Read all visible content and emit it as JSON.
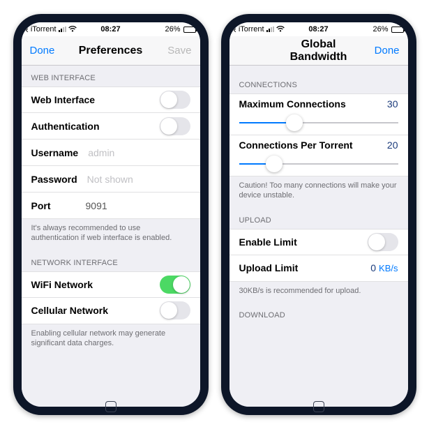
{
  "status": {
    "app_name": "iTorrent",
    "time": "08:27",
    "battery_pct": "26%"
  },
  "left": {
    "nav": {
      "left": "Done",
      "title": "Preferences",
      "right": "Save"
    },
    "section1_header": "WEB INTERFACE",
    "rows": {
      "web_interface": "Web Interface",
      "authentication": "Authentication",
      "username_label": "Username",
      "username_value": "admin",
      "password_label": "Password",
      "password_value": "Not shown",
      "port_label": "Port",
      "port_value": "9091"
    },
    "section1_footer": "It's always recommended to use authentication if web interface is enabled.",
    "section2_header": "NETWORK INTERFACE",
    "wifi_label": "WiFi Network",
    "cellular_label": "Cellular Network",
    "section2_footer": "Enabling cellular network may generate significant data charges."
  },
  "right": {
    "nav": {
      "title": "Global Bandwidth",
      "right": "Done"
    },
    "section1_header": "CONNECTIONS",
    "max_conn_label": "Maximum Connections",
    "max_conn_value": "30",
    "conn_per_torrent_label": "Connections Per Torrent",
    "conn_per_torrent_value": "20",
    "conn_footer": "Caution! Too many connections will make your device unstable.",
    "section2_header": "UPLOAD",
    "enable_limit_label": "Enable Limit",
    "upload_limit_label": "Upload Limit",
    "upload_limit_value": "0",
    "upload_limit_unit": "KB/s",
    "upload_footer": "30KB/s is recommended for upload.",
    "section3_header": "DOWNLOAD"
  }
}
